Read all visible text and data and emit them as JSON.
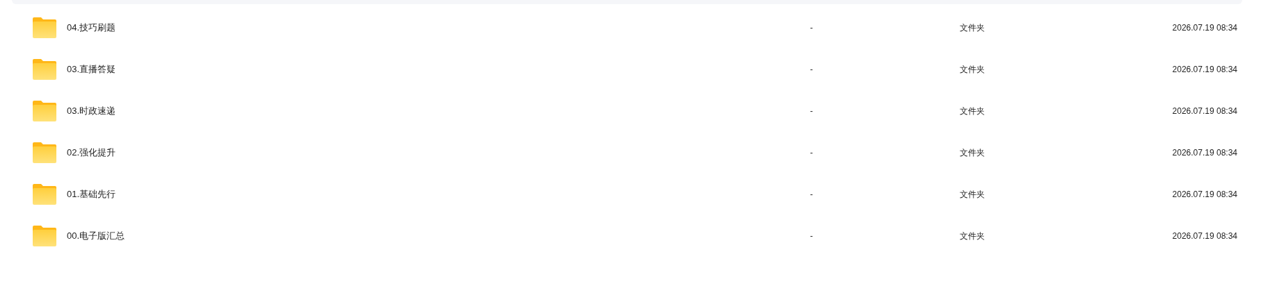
{
  "rows": [
    {
      "name": "04.技巧刷题",
      "size": "-",
      "type": "文件夹",
      "modified": "2026.07.19 08:34"
    },
    {
      "name": "03.直播答疑",
      "size": "-",
      "type": "文件夹",
      "modified": "2026.07.19 08:34"
    },
    {
      "name": "03.时政速递",
      "size": "-",
      "type": "文件夹",
      "modified": "2026.07.19 08:34"
    },
    {
      "name": "02.强化提升",
      "size": "-",
      "type": "文件夹",
      "modified": "2026.07.19 08:34"
    },
    {
      "name": "01.基础先行",
      "size": "-",
      "type": "文件夹",
      "modified": "2026.07.19 08:34"
    },
    {
      "name": "00.电子版汇总",
      "size": "-",
      "type": "文件夹",
      "modified": "2026.07.19 08:34"
    }
  ]
}
